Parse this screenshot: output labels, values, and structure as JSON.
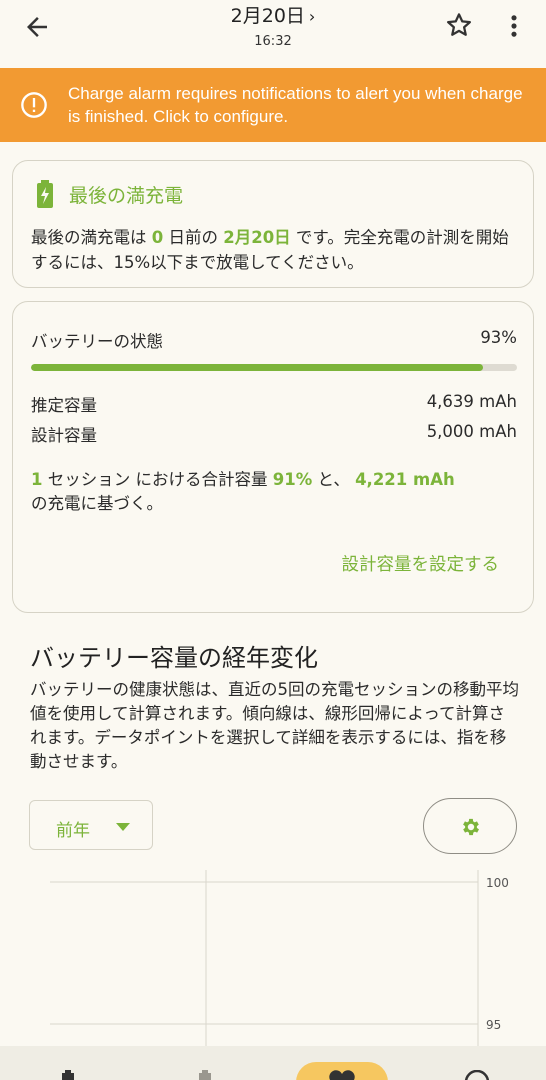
{
  "header": {
    "title": "2月20日",
    "title_chevron": "›",
    "time": "16:32",
    "icons": {
      "back": "arrow-left-icon",
      "star": "star-icon",
      "more": "more-vert-icon"
    }
  },
  "banner": {
    "message": "Charge alarm requires notifications to alert you when charge is finished. Click to configure.",
    "icon": "info-circle-icon",
    "color": "#f29a32"
  },
  "last_full_charge": {
    "title": "最後の満充電",
    "text_1": "最後の満充電は ",
    "days": "0",
    "text_2": " 日前の ",
    "date": "2月20日",
    "text_3": " です。完全充電の計測を開始するには、15%以下まで放電してください。"
  },
  "battery_health": {
    "label": "バッテリーの状態",
    "percent": "93%",
    "fill_fraction": 0.93,
    "estimated_label": "推定容量",
    "estimated_value": "4,639 mAh",
    "design_label": "設計容量",
    "design_value": "5,000 mAh",
    "session_count": "1",
    "session_text_1": " セッション における合計容量 ",
    "session_percent": "91%",
    "session_text_2": " と、 ",
    "session_mah": "4,221 mAh",
    "session_text_3": "の充電に基づく。",
    "set_design_link": "設計容量を設定する"
  },
  "capacity_section": {
    "title": "バッテリー容量の経年変化",
    "description": "バッテリーの健康状態は、直近の5回の充電セッションの移動平均値を使用して計算されます。傾向線は、線形回帰によって計算されます。データポイントを選択して詳細を表示するには、指を移動させます。",
    "period": "前年",
    "settings_icon": "gear-icon"
  },
  "chart_data": {
    "type": "line",
    "y_ticks": [
      "100",
      "95"
    ],
    "series": []
  },
  "colors": {
    "accent": "#7cb43a",
    "banner": "#f29a32",
    "nav_active": "#f6c760"
  }
}
